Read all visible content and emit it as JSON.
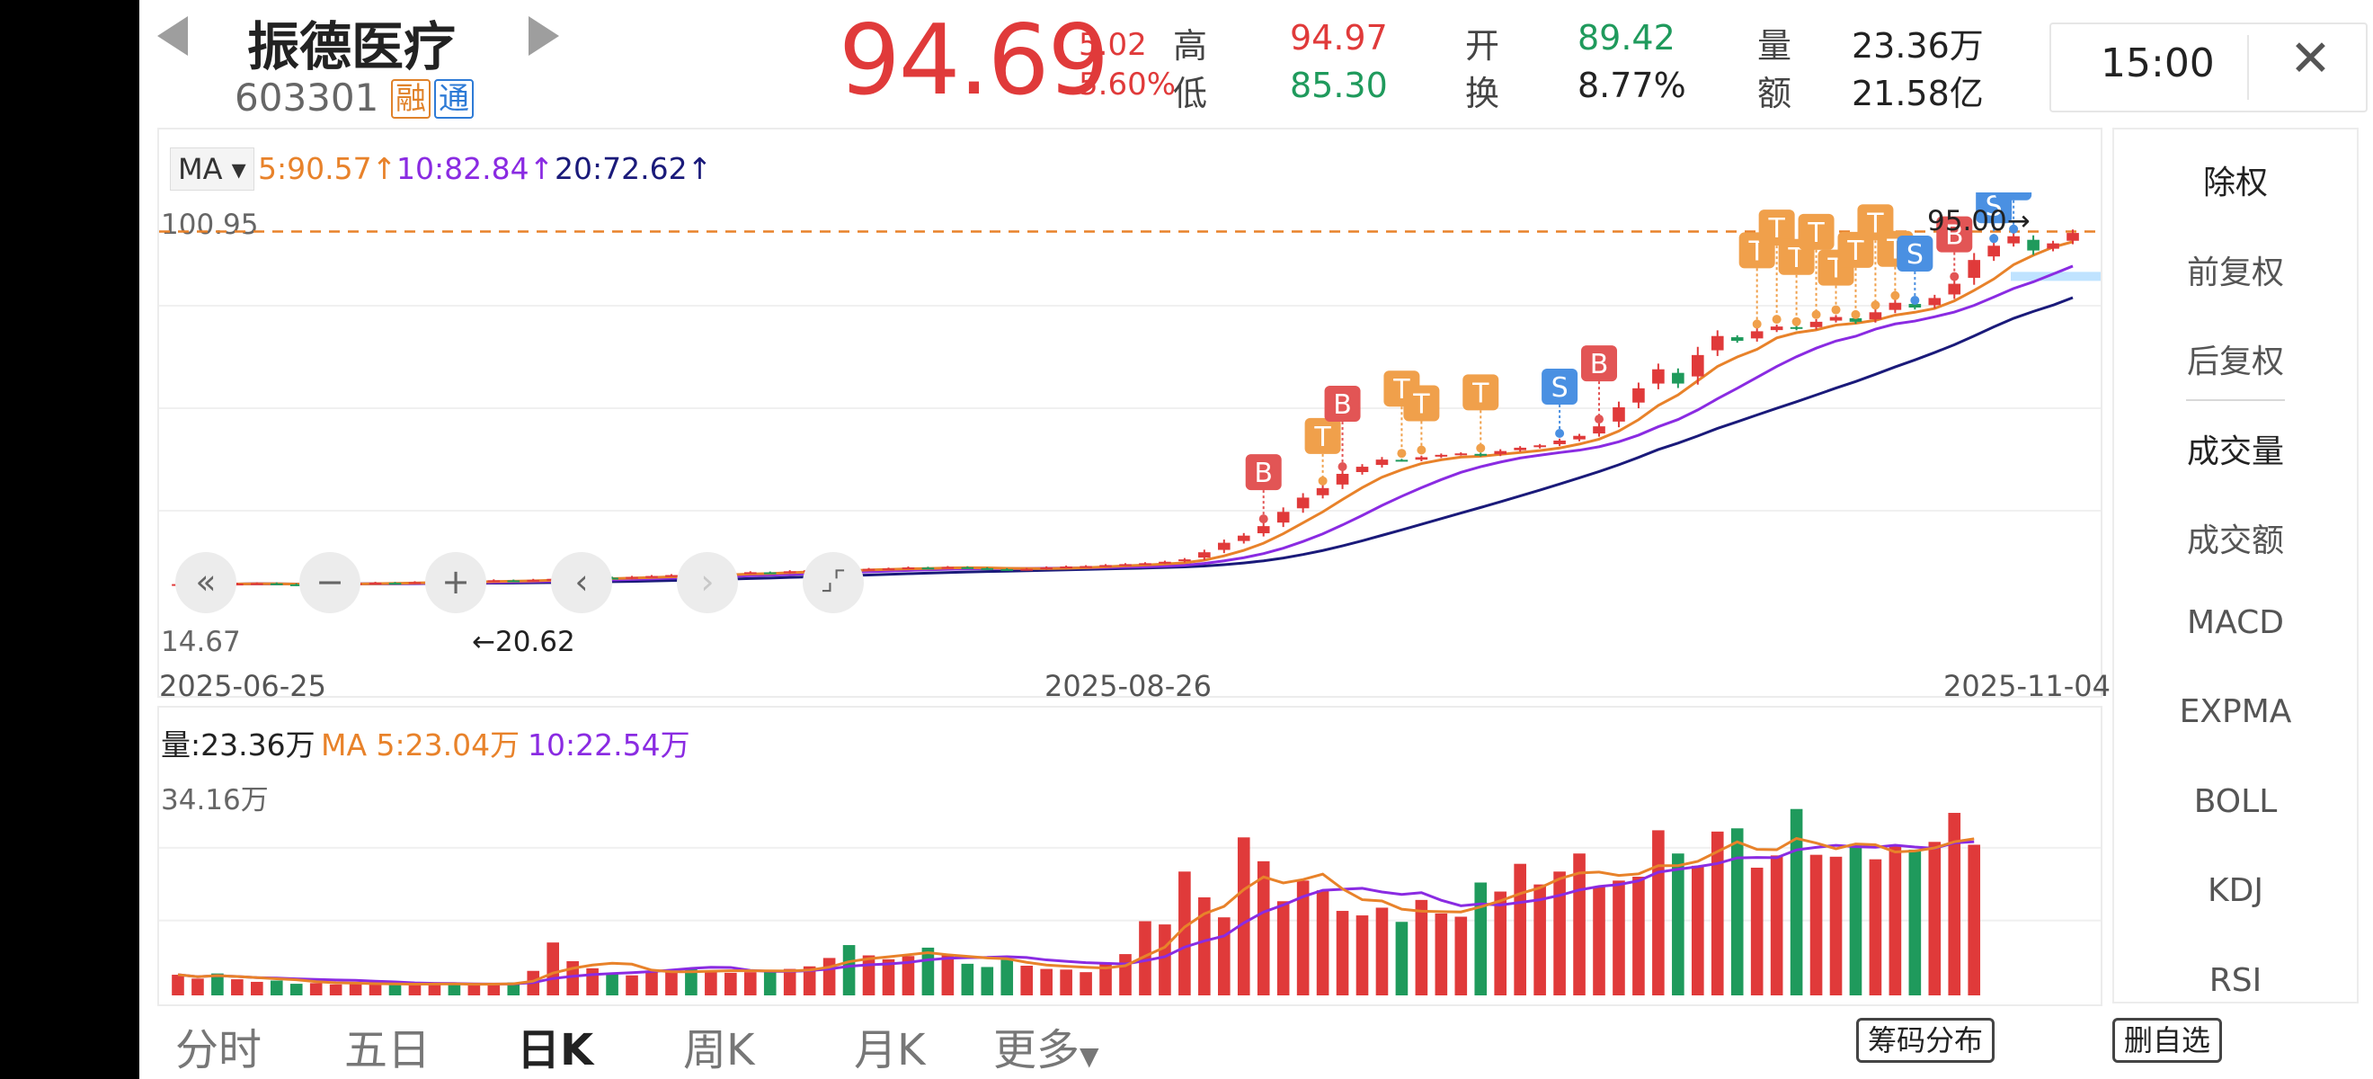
{
  "header": {
    "name": "振德医疗",
    "code": "603301",
    "tag_rong": "融",
    "tag_tong": "通",
    "price": "94.69",
    "change": "5.02",
    "change_pct": "5.60%",
    "quote": {
      "high_label": "高",
      "high": "94.97",
      "low_label": "低",
      "low": "85.30",
      "open_label": "开",
      "open": "89.42",
      "turnover_label": "换",
      "turnover": "8.77%",
      "volume_label": "量",
      "volume": "23.36万",
      "amount_label": "额",
      "amount": "21.58亿"
    },
    "time": "15:00"
  },
  "chart": {
    "ma_selector": "MA",
    "ma5": "5:90.57↑",
    "ma10": "10:82.84↑",
    "ma20": "20:72.62↑",
    "y_top": "100.95",
    "y_bottom": "14.67",
    "max_marker": "95.00→",
    "min_marker": "←20.62",
    "dates": [
      "2025-06-25",
      "2025-08-26",
      "2025-11-04"
    ],
    "signals": [
      {
        "t": "B",
        "c": "red"
      },
      {
        "t": "T",
        "c": "orange"
      },
      {
        "t": "B",
        "c": "red"
      },
      {
        "t": "T",
        "c": "orange"
      },
      {
        "t": "T",
        "c": "orange"
      },
      {
        "t": "T",
        "c": "orange"
      },
      {
        "t": "S",
        "c": "blue"
      },
      {
        "t": "B",
        "c": "red"
      },
      {
        "t": "T",
        "c": "orange"
      },
      {
        "t": "T",
        "c": "orange"
      },
      {
        "t": "T",
        "c": "orange"
      },
      {
        "t": "T",
        "c": "orange"
      },
      {
        "t": "T",
        "c": "orange"
      },
      {
        "t": "T",
        "c": "orange"
      },
      {
        "t": "T",
        "c": "orange"
      },
      {
        "t": "T",
        "c": "orange"
      },
      {
        "t": "S",
        "c": "blue"
      },
      {
        "t": "B",
        "c": "red"
      },
      {
        "t": "S",
        "c": "blue"
      },
      {
        "t": "S",
        "c": "blue"
      }
    ]
  },
  "volume": {
    "label": "量:23.36万",
    "ma5": "MA 5:23.04万",
    "ma10": "10:22.54万",
    "y_top": "34.16万"
  },
  "indicators": [
    "除权",
    "前复权",
    "后复权",
    "成交量",
    "成交额",
    "MACD",
    "EXPMA",
    "BOLL",
    "KDJ",
    "RSI"
  ],
  "tabs": [
    "分时",
    "五日",
    "日K",
    "周K",
    "月K",
    "更多"
  ],
  "buttons": {
    "chip": "筹码分布",
    "remove_fav": "删自选"
  },
  "colors": {
    "up": "#e03a3a",
    "down": "#1f9a5c",
    "ma5": "#e8822a",
    "ma10": "#8a2be2",
    "ma20": "#1a1a7a",
    "dash": "#e8822a"
  },
  "chart_data": {
    "type": "candlestick",
    "ylim": [
      14.67,
      100.95
    ],
    "close": [
      20.8,
      20.9,
      20.7,
      20.9,
      21.0,
      20.8,
      20.6,
      20.8,
      20.9,
      21.0,
      21.1,
      21.0,
      21.2,
      21.3,
      21.2,
      21.4,
      21.6,
      21.5,
      21.7,
      21.9,
      22.0,
      22.2,
      22.0,
      22.3,
      22.5,
      22.7,
      22.6,
      22.9,
      23.1,
      23.3,
      23.2,
      23.5,
      23.7,
      23.9,
      23.8,
      24.0,
      24.1,
      24.3,
      24.2,
      24.4,
      24.2,
      24.0,
      23.8,
      24.0,
      24.3,
      24.5,
      24.6,
      24.8,
      25.0,
      25.2,
      25.5,
      26.0,
      27.5,
      29.5,
      31.0,
      33.0,
      36.0,
      39.0,
      41.0,
      44.0,
      45.5,
      47.0,
      46.8,
      47.5,
      48.0,
      48.3,
      47.9,
      48.8,
      49.5,
      50.0,
      51.0,
      52.0,
      54.0,
      58.0,
      62.0,
      66.0,
      63.0,
      69.0,
      73.0,
      72.0,
      74.0,
      75.0,
      74.5,
      76.0,
      77.0,
      76.0,
      78.0,
      80.0,
      79.0,
      81.0,
      84.0,
      89.0,
      92.0,
      94.0,
      91.0,
      92.5,
      94.69
    ],
    "volume_wan": [
      3.2,
      2.6,
      3.4,
      2.5,
      2.1,
      2.3,
      1.8,
      1.9,
      1.7,
      1.8,
      1.9,
      1.6,
      1.7,
      1.8,
      1.9,
      1.6,
      1.7,
      2.0,
      3.8,
      8.2,
      5.3,
      4.2,
      3.4,
      3.1,
      3.6,
      4.0,
      4.2,
      3.8,
      3.5,
      3.6,
      3.9,
      4.1,
      4.5,
      5.8,
      7.8,
      6.2,
      5.6,
      6.1,
      7.4,
      6.2,
      4.9,
      4.4,
      5.5,
      4.6,
      4.1,
      4.0,
      3.6,
      4.9,
      6.4,
      11.5,
      11.0,
      19.2,
      15.2,
      12.1,
      24.5,
      20.8,
      14.6,
      17.8,
      16.3,
      13.1,
      12.4,
      13.6,
      11.4,
      14.8,
      12.7,
      12.2,
      17.5,
      16.1,
      20.4,
      17.2,
      19.2,
      22.0,
      16.8,
      17.8,
      18.4,
      25.6,
      22.0,
      20.1,
      25.4,
      25.9,
      19.8,
      21.7,
      28.9,
      21.8,
      21.5,
      23.5,
      21.1,
      23.3,
      22.6,
      23.8,
      28.3,
      23.36
    ]
  }
}
